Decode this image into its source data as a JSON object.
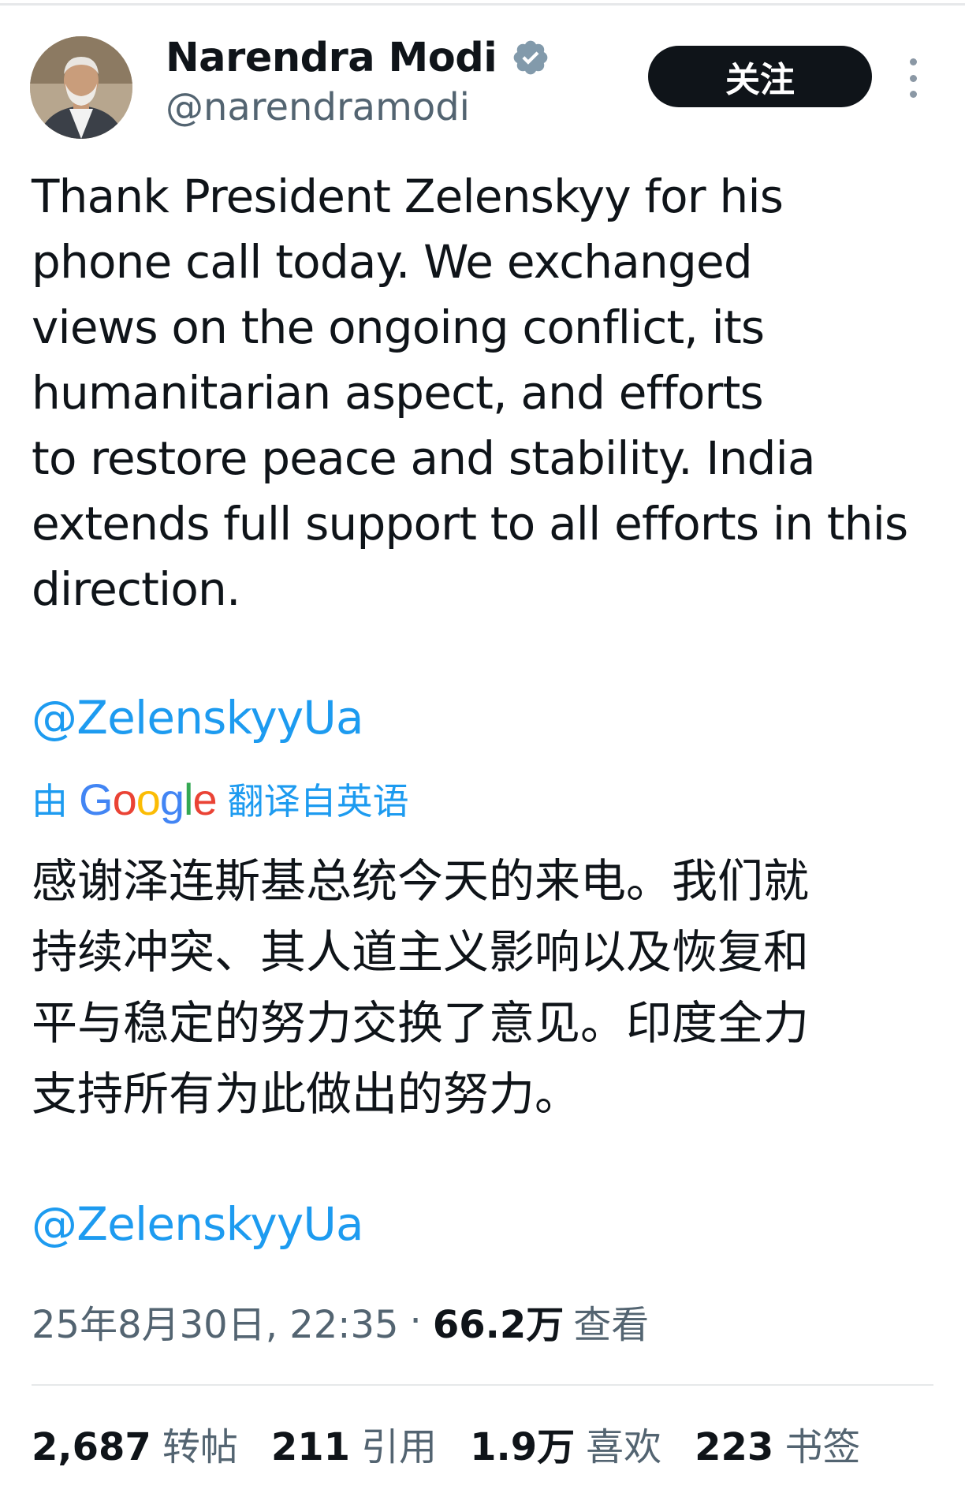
{
  "author": {
    "display_name": "Narendra Modi",
    "handle": "@narendramodi"
  },
  "follow_label": "关注",
  "tweet": {
    "text_lines": [
      "Thank President Zelenskyy for his",
      "phone call today. We exchanged",
      "views on the ongoing conflict, its",
      "humanitarian aspect, and efforts",
      "to restore peace and stability. India",
      "extends full support to all efforts in this",
      "direction."
    ],
    "mention": "@ZelenskyyUa"
  },
  "translation": {
    "prefix": "由",
    "logo_text": "Google",
    "suffix": "翻译自英语",
    "text_lines": [
      "感谢泽连斯基总统今天的来电。我们就",
      "持续冲突、其人道主义影响以及恢复和",
      "平与稳定的努力交换了意见。印度全力",
      "支持所有为此做出的努力。"
    ],
    "mention": "@ZelenskyyUa"
  },
  "meta": {
    "timestamp": "25年8月30日, 22:35",
    "separator": "·",
    "views_count": "66.2万",
    "views_label": "查看"
  },
  "stats": {
    "reposts": {
      "count": "2,687",
      "label": "转帖"
    },
    "quotes": {
      "count": "211",
      "label": "引用"
    },
    "likes": {
      "count": "1.9万",
      "label": "喜欢"
    },
    "bookmarks": {
      "count": "223",
      "label": "书签"
    }
  },
  "colors": {
    "link": "#1d9bf0",
    "secondary_text": "#536471",
    "primary_text": "#0f1419",
    "verified_badge": "#829aab"
  },
  "icons": [
    "verified-badge-icon",
    "more-options-icon"
  ]
}
